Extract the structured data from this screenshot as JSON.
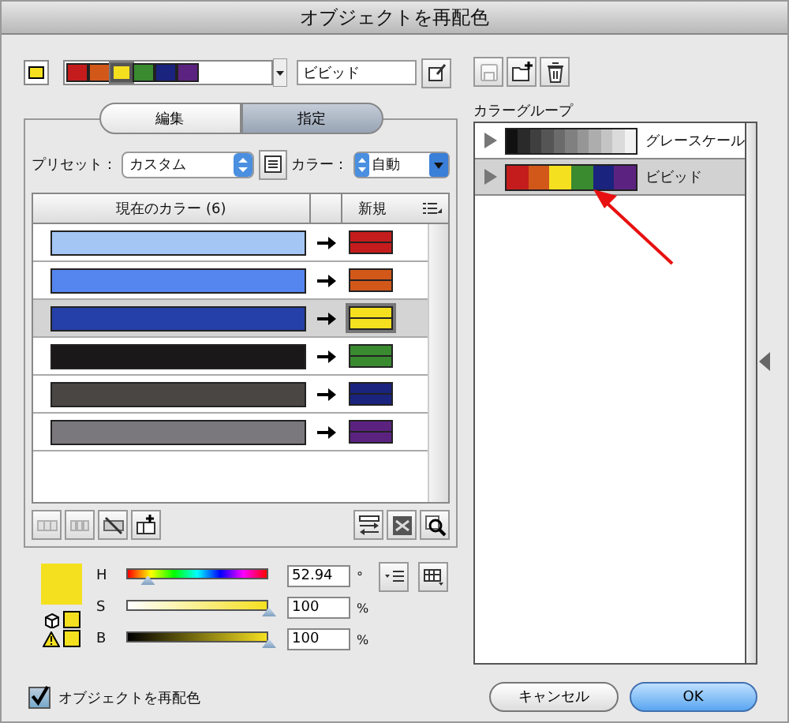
{
  "window": {
    "title": "オブジェクトを再配色"
  },
  "top": {
    "swatch": {
      "color": "#f5e020"
    },
    "strip": [
      {
        "color": "#c41c1c",
        "selected": false
      },
      {
        "color": "#d2581a",
        "selected": false
      },
      {
        "color": "#f5e020",
        "selected": true
      },
      {
        "color": "#3a8a30",
        "selected": false
      },
      {
        "color": "#1a237e",
        "selected": false
      },
      {
        "color": "#5c2280",
        "selected": false
      }
    ],
    "name_value": "ビビッド"
  },
  "tabs": [
    {
      "label": "編集",
      "selected": false
    },
    {
      "label": "指定",
      "selected": true
    }
  ],
  "preset": {
    "label": "プリセット：",
    "value": "カスタム"
  },
  "color_option": {
    "label": "カラー：",
    "value": "自動"
  },
  "table": {
    "columns": [
      "現在のカラー (6)",
      "新規"
    ],
    "rows": [
      {
        "current": {
          "color": "#a4c6f5"
        },
        "new": {
          "color": "#c41c1c"
        },
        "selected": false
      },
      {
        "current": {
          "color": "#5585ee"
        },
        "new": {
          "color": "#d2581a"
        },
        "selected": false
      },
      {
        "current": {
          "color": "#2540a8"
        },
        "new": {
          "color": "#f5e020"
        },
        "selected": true
      },
      {
        "current": {
          "color": "#1a1818"
        },
        "new": {
          "color": "#3a8a30"
        },
        "selected": false
      },
      {
        "current": {
          "color": "#4a4644"
        },
        "new": {
          "color": "#1a237e"
        },
        "selected": false
      },
      {
        "current": {
          "color": "#7a787c"
        },
        "new": {
          "color": "#5c2280"
        },
        "selected": false
      }
    ]
  },
  "hsb": {
    "color": "#f5e020",
    "sliders": [
      {
        "label": "H",
        "kind": "hue",
        "level": 0.147,
        "value": "52.94",
        "unit": "°"
      },
      {
        "label": "S",
        "kind": "saturation",
        "level": 1,
        "value": "100",
        "unit": "%"
      },
      {
        "label": "B",
        "kind": "brightness",
        "level": 1,
        "value": "100",
        "unit": "%"
      }
    ]
  },
  "recolor_checkbox": {
    "label": "オブジェクトを再配色",
    "checked": true
  },
  "color_groups": {
    "label": "カラーグループ",
    "items": [
      {
        "name": "グレースケール",
        "selected": false,
        "swatches": [
          {
            "color": "#111111"
          },
          {
            "color": "#2a2a2a"
          },
          {
            "color": "#3f3f3f"
          },
          {
            "color": "#555555"
          },
          {
            "color": "#6b6b6b"
          },
          {
            "color": "#808080"
          },
          {
            "color": "#969696"
          },
          {
            "color": "#adadad"
          },
          {
            "color": "#c4c4c4"
          },
          {
            "color": "#dbdbdb"
          },
          {
            "color": "#f2f2f2"
          }
        ]
      },
      {
        "name": "ビビッド",
        "selected": true,
        "swatches": [
          {
            "color": "#c41c1c"
          },
          {
            "color": "#d2581a"
          },
          {
            "color": "#f5e020"
          },
          {
            "color": "#3a8a30"
          },
          {
            "color": "#1a237e"
          },
          {
            "color": "#5c2280"
          }
        ]
      }
    ]
  },
  "buttons": [
    {
      "label": "キャンセル",
      "kind": "cancel"
    },
    {
      "label": "OK",
      "kind": "default"
    }
  ]
}
